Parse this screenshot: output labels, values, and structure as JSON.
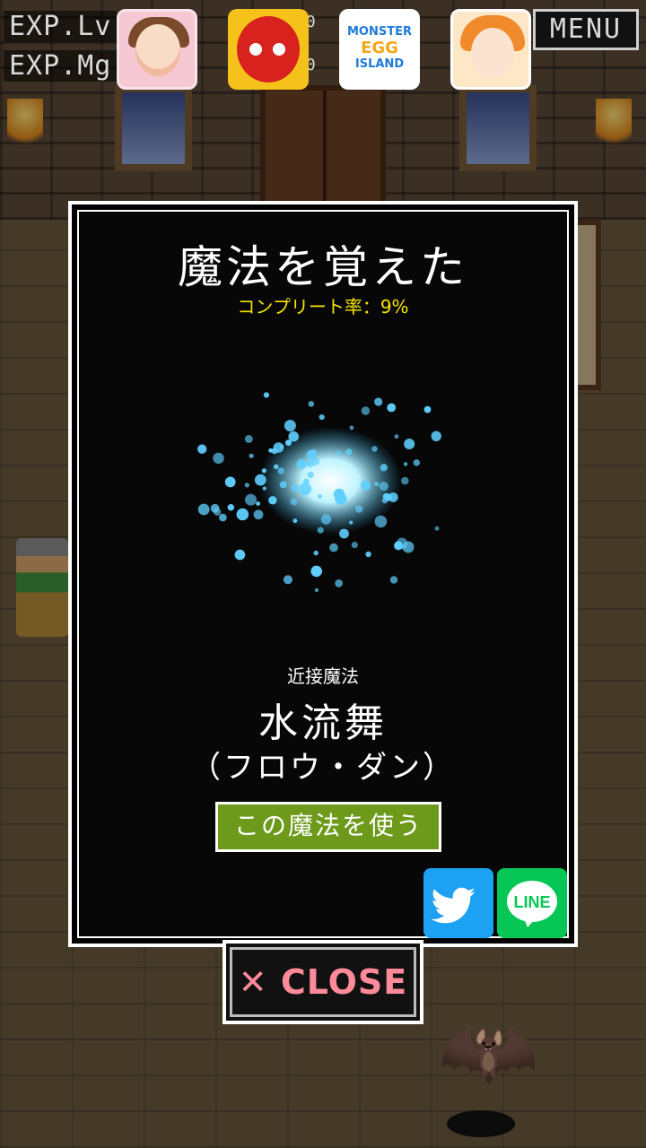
{
  "hud": {
    "exp_lv_label": "EXP.Lv",
    "exp_mg_label": "EXP.Mg",
    "exp_lv_value": "00",
    "exp_mg_value": "00",
    "menu_label": "MENU"
  },
  "ads": [
    {
      "name": "app-icon-girl",
      "icon": "girl-portrait-icon"
    },
    {
      "name": "app-icon-red-monster",
      "icon": "red-monster-icon"
    },
    {
      "name": "app-icon-monster-egg-island",
      "icon": "monster-egg-island-logo",
      "logo_lines": [
        "MONSTER",
        "EGG",
        "ISLAND"
      ]
    },
    {
      "name": "app-icon-anime-girl",
      "icon": "anime-girl-portrait-icon"
    }
  ],
  "modal": {
    "title": "魔法を覚えた",
    "complete_rate": "コンプリート率：9%",
    "spell_category": "近接魔法",
    "spell_name": "水流舞",
    "spell_reading": "（フロウ・ダン）",
    "use_button": "この魔法を使う",
    "share_twitter": "twitter-icon",
    "share_line": "LINE",
    "effect_icon": "water-splash-effect"
  },
  "close_button": "✕ CLOSE",
  "colors": {
    "title": "#ffffff",
    "complete_rate": "#f5e400",
    "use_button_bg": "#6d9a1b",
    "close_text": "#ff8a9a",
    "twitter": "#1da1f2",
    "line": "#06c755"
  }
}
